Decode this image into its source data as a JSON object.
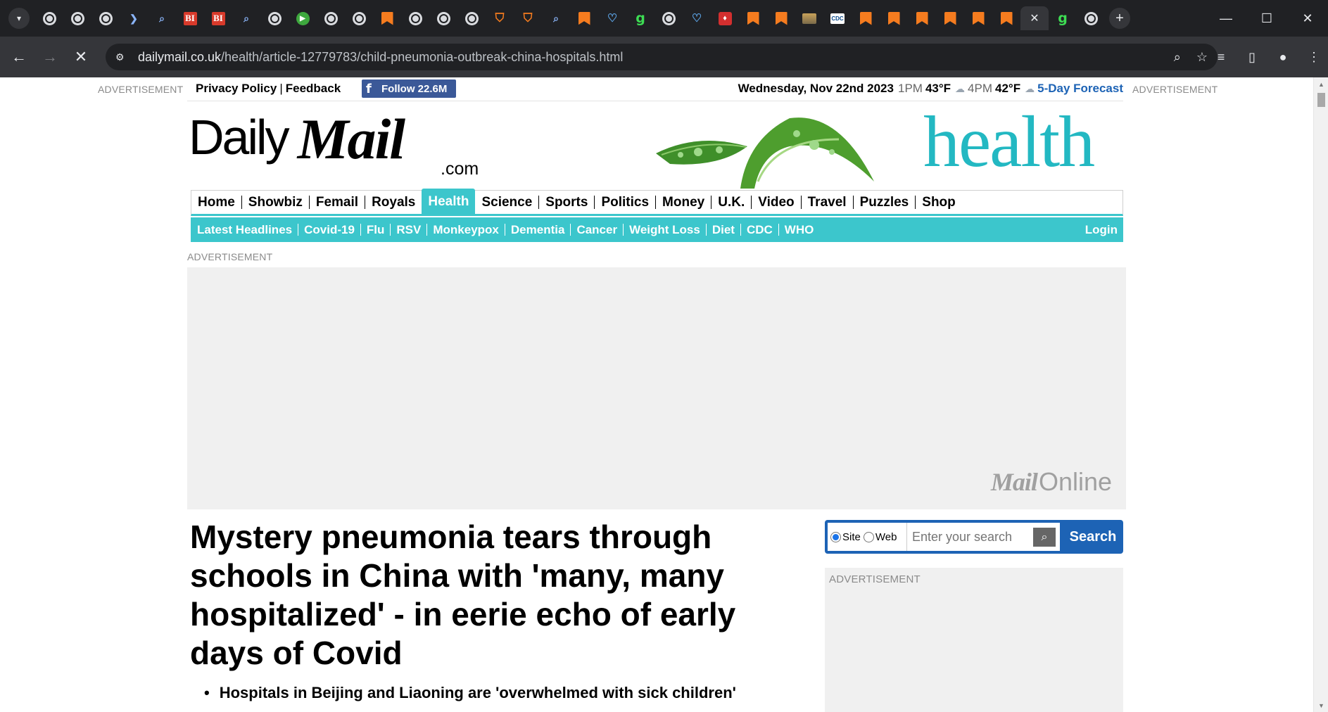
{
  "browser": {
    "url_domain": "dailymail.co.uk",
    "url_path": "/health/article-12779783/child-pneumonia-outbreak-china-hospitals.html",
    "tabs": [
      {
        "icon": "globe-icon"
      },
      {
        "icon": "globe-icon"
      },
      {
        "icon": "globe-icon"
      },
      {
        "icon": "arrow-icon"
      },
      {
        "icon": "search-icon"
      },
      {
        "icon": "bi-icon",
        "text": "BI"
      },
      {
        "icon": "bi-icon",
        "text": "BI"
      },
      {
        "icon": "search-icon"
      },
      {
        "icon": "globe-icon"
      },
      {
        "icon": "play-icon"
      },
      {
        "icon": "globe-icon"
      },
      {
        "icon": "globe-icon"
      },
      {
        "icon": "bookmark-icon"
      },
      {
        "icon": "globe-icon"
      },
      {
        "icon": "globe-icon"
      },
      {
        "icon": "globe-icon"
      },
      {
        "icon": "shield-icon"
      },
      {
        "icon": "shield-icon"
      },
      {
        "icon": "search-icon"
      },
      {
        "icon": "bookmark-icon"
      },
      {
        "icon": "heart-icon"
      },
      {
        "icon": "g-icon",
        "text": "g"
      },
      {
        "icon": "globe-icon"
      },
      {
        "icon": "heart-icon"
      },
      {
        "icon": "red-icon"
      },
      {
        "icon": "bookmark-icon"
      },
      {
        "icon": "bookmark-icon"
      },
      {
        "icon": "picture-icon"
      },
      {
        "icon": "cdc-icon",
        "text": "CDC"
      },
      {
        "icon": "bookmark-icon"
      },
      {
        "icon": "bookmark-icon"
      },
      {
        "icon": "bookmark-icon"
      },
      {
        "icon": "bookmark-icon"
      },
      {
        "icon": "bookmark-icon"
      },
      {
        "icon": "bookmark-icon"
      }
    ],
    "active_tab_index": 35,
    "after_active_tabs": [
      {
        "icon": "g-icon",
        "text": "g"
      },
      {
        "icon": "globe-icon"
      }
    ]
  },
  "topbar": {
    "ad_left": "ADVERTISEMENT",
    "ad_right": "ADVERTISEMENT",
    "privacy": "Privacy Policy",
    "feedback": "Feedback",
    "follow": "Follow 22.6M",
    "date": "Wednesday, Nov 22nd 2023",
    "time1": "1PM",
    "temp1": "43°F",
    "time2": "4PM",
    "temp2": "42°F",
    "forecast": "5-Day Forecast"
  },
  "masthead": {
    "daily": "Daily",
    "mail": "Mail",
    "com": ".com",
    "section": "health"
  },
  "mainnav": [
    "Home",
    "Showbiz",
    "Femail",
    "Royals",
    "Health",
    "Science",
    "Sports",
    "Politics",
    "Money",
    "U.K.",
    "Video",
    "Travel",
    "Puzzles",
    "Shop"
  ],
  "mainnav_active": "Health",
  "subnav": [
    "Latest Headlines",
    "Covid-19",
    "Flu",
    "RSV",
    "Monkeypox",
    "Dementia",
    "Cancer",
    "Weight Loss",
    "Diet",
    "CDC",
    "WHO"
  ],
  "login": "Login",
  "ad_mid": "ADVERTISEMENT",
  "mailonline": {
    "mail": "Mail",
    "online": "Online"
  },
  "article": {
    "headline": "Mystery pneumonia tears through schools in China with 'many, many hospitalized' - in eerie echo of early days of Covid",
    "bullets": [
      "Hospitals in Beijing and Liaoning are 'overwhelmed with sick children'"
    ]
  },
  "search": {
    "site_label": "Site",
    "web_label": "Web",
    "placeholder": "Enter your search",
    "button": "Search",
    "selected": "Site"
  },
  "right_ad": "ADVERTISEMENT",
  "colors": {
    "accent": "#3cc6cc",
    "search_blue": "#1d63b5",
    "facebook": "#3b5998"
  }
}
